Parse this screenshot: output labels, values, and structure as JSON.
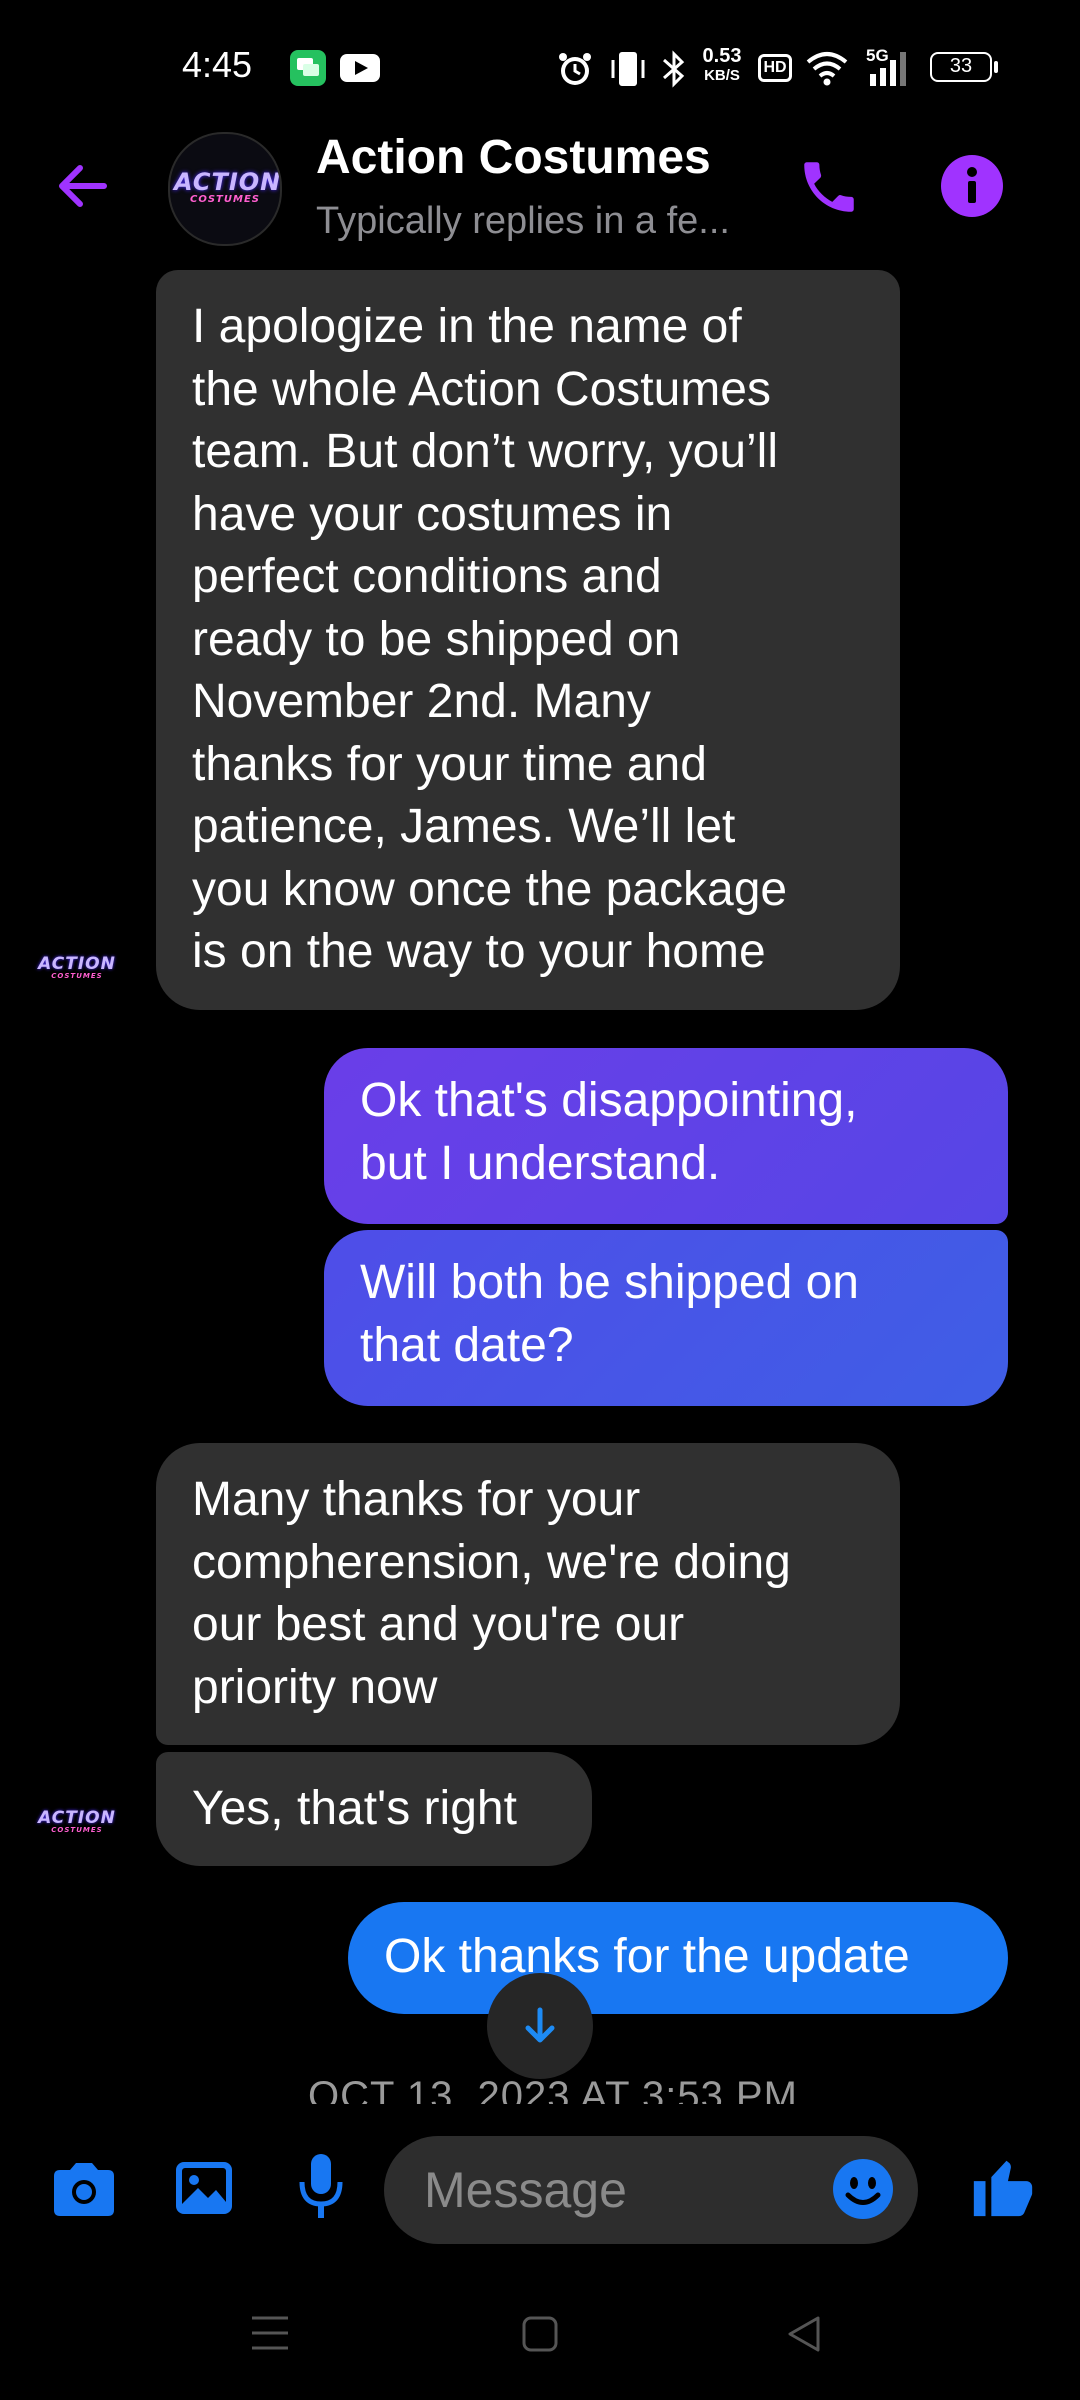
{
  "status_bar": {
    "time": "4:45",
    "net_speed_value": "0.53",
    "net_speed_unit": "KB/S",
    "hd_badge": "HD",
    "signal_type": "5G",
    "battery": "33"
  },
  "header": {
    "title": "Action Costumes",
    "subtitle": "Typically replies in a fe...",
    "logo_main": "ACTION",
    "logo_sub": "COSTUMES"
  },
  "messages": [
    {
      "from": "them",
      "lines": [
        "I apologize in the name of",
        "the whole Action Costumes",
        "team. But don’t worry, you’ll",
        "have your costumes in",
        "perfect conditions and",
        "ready to be shipped on",
        "November 2nd. Many",
        "thanks for your time and",
        "patience, James. We’ll let",
        "you know once the package",
        "is on the way to your home"
      ]
    },
    {
      "from": "me",
      "lines": [
        "Ok that's disappointing,",
        "but I understand."
      ]
    },
    {
      "from": "me",
      "lines": [
        "Will both be shipped on",
        "that date?"
      ]
    },
    {
      "from": "them",
      "lines": [
        "Many thanks for your",
        "compherension, we're doing",
        "our best and you're our",
        "priority now"
      ]
    },
    {
      "from": "them",
      "lines": [
        "Yes, that's right"
      ]
    },
    {
      "from": "me",
      "lines": [
        "Ok thanks for the update"
      ]
    }
  ],
  "timestamp": "OCT 13, 2023 AT 3:53 PM",
  "composer": {
    "placeholder": "Message"
  },
  "colors": {
    "accent": "#a033ff",
    "received_bubble": "#303030",
    "sent_gradient_top": "#5b3fe6",
    "sent_gradient_mid": "#4a56e8",
    "sent_last": "#1877f2",
    "composer_icons": "#1877f2"
  },
  "icons": [
    "back-arrow-icon",
    "phone-icon",
    "info-icon",
    "camera-icon",
    "gallery-icon",
    "microphone-icon",
    "emoji-icon",
    "thumbs-up-icon",
    "scroll-down-icon"
  ]
}
